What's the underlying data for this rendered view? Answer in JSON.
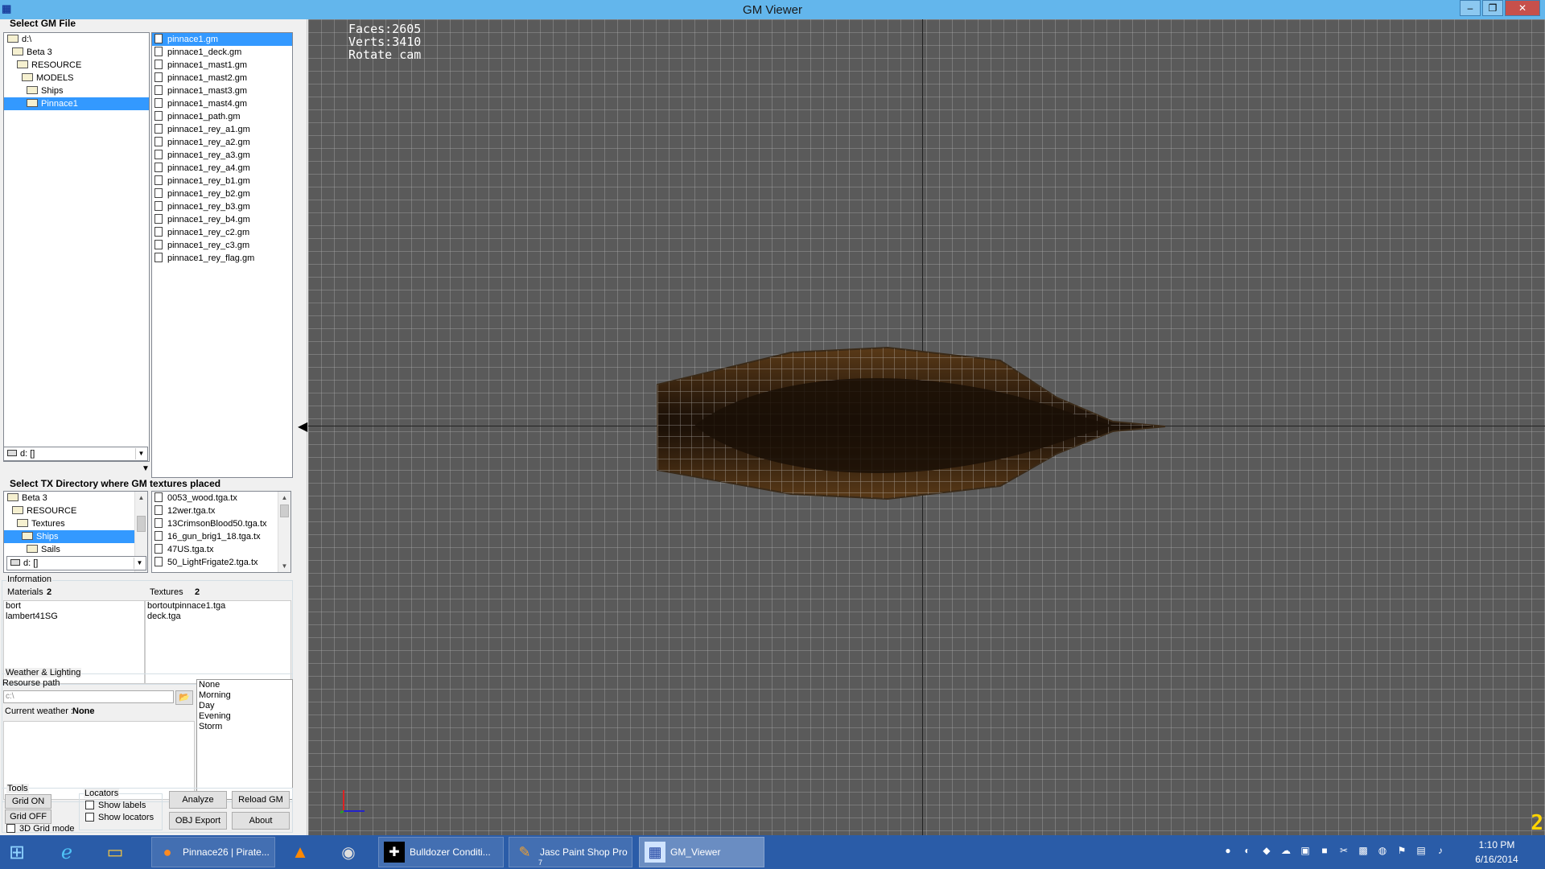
{
  "window": {
    "title": "GM Viewer",
    "min_glyph": "–",
    "restore_glyph": "❐",
    "close_glyph": "✕"
  },
  "gm_file": {
    "section_title": "Select GM File",
    "tree": [
      "d:\\",
      "Beta 3",
      "RESOURCE",
      "MODELS",
      "Ships",
      "Pinnace1"
    ],
    "tree_selected": "Pinnace1",
    "drive": "d: []",
    "files": [
      "pinnace1.gm",
      "pinnace1_deck.gm",
      "pinnace1_mast1.gm",
      "pinnace1_mast2.gm",
      "pinnace1_mast3.gm",
      "pinnace1_mast4.gm",
      "pinnace1_path.gm",
      "pinnace1_rey_a1.gm",
      "pinnace1_rey_a2.gm",
      "pinnace1_rey_a3.gm",
      "pinnace1_rey_a4.gm",
      "pinnace1_rey_b1.gm",
      "pinnace1_rey_b2.gm",
      "pinnace1_rey_b3.gm",
      "pinnace1_rey_b4.gm",
      "pinnace1_rey_c2.gm",
      "pinnace1_rey_c3.gm",
      "pinnace1_rey_flag.gm"
    ],
    "file_selected": "pinnace1.gm"
  },
  "tx_dir": {
    "section_title": "Select TX Directory where GM textures placed",
    "tree": [
      "Beta 3",
      "RESOURCE",
      "Textures",
      "Ships",
      "Sails"
    ],
    "tree_selected": "Ships",
    "drive": "d: []",
    "files": [
      "0053_wood.tga.tx",
      "12wer.tga.tx",
      "13CrimsonBlood50.tga.tx",
      "16_gun_brig1_18.tga.tx",
      "47US.tga.tx",
      "50_LightFrigate2.tga.tx"
    ]
  },
  "information": {
    "group_label": "Information",
    "materials_label": "Materials",
    "materials_count": "2",
    "textures_label": "Textures",
    "textures_count": "2",
    "materials": [
      "bort",
      "lambert41SG"
    ],
    "textures": [
      "bortoutpinnace1.tga",
      "deck.tga"
    ]
  },
  "weather": {
    "group_label": "Weather & Lighting",
    "resource_path_label": "Resourse path",
    "resource_path_value": "c:\\",
    "current_weather_label": "Current weather :",
    "current_weather_value": "None",
    "options": [
      "None",
      "Morning",
      "Day",
      "Evening",
      "Storm"
    ]
  },
  "tools": {
    "group_label": "Tools",
    "grid_on": "Grid ON",
    "grid_off": "Grid OFF",
    "grid3d": "3D Grid mode",
    "locators_label": "Locators",
    "show_labels": "Show labels",
    "show_locators": "Show locators",
    "analyze": "Analyze",
    "reload": "Reload GM",
    "obj_export": "OBJ Export",
    "about": "About"
  },
  "viewport": {
    "faces": "Faces:2605",
    "verts": "Verts:3410",
    "mode": "Rotate cam",
    "corner_indicator": "2"
  },
  "taskbar": {
    "items": [
      {
        "label": "",
        "icon": "windows-start-icon"
      },
      {
        "label": "",
        "icon": "internet-explorer-icon"
      },
      {
        "label": "",
        "icon": "file-explorer-icon"
      },
      {
        "label": "Pinnace26 | Pirate...",
        "icon": "firefox-icon"
      },
      {
        "label": "",
        "icon": "vlc-icon"
      },
      {
        "label": "",
        "icon": "camera-app-icon"
      },
      {
        "label": "Bulldozer Conditi...",
        "icon": "bulldozer-app-icon"
      },
      {
        "label": "Jasc Paint Shop Pro",
        "icon": "paint-shop-pro-icon",
        "badge": "7"
      },
      {
        "label": "GM_Viewer",
        "icon": "gm-viewer-icon"
      }
    ],
    "clock_time": "1:10 PM",
    "clock_date": "6/16/2014"
  },
  "colors": {
    "titlebar": "#63b6ec",
    "selection": "#3399ff",
    "viewport_bg": "#5a5a5a",
    "taskbar": "#2a5ca8",
    "hull": "#3a2410"
  }
}
